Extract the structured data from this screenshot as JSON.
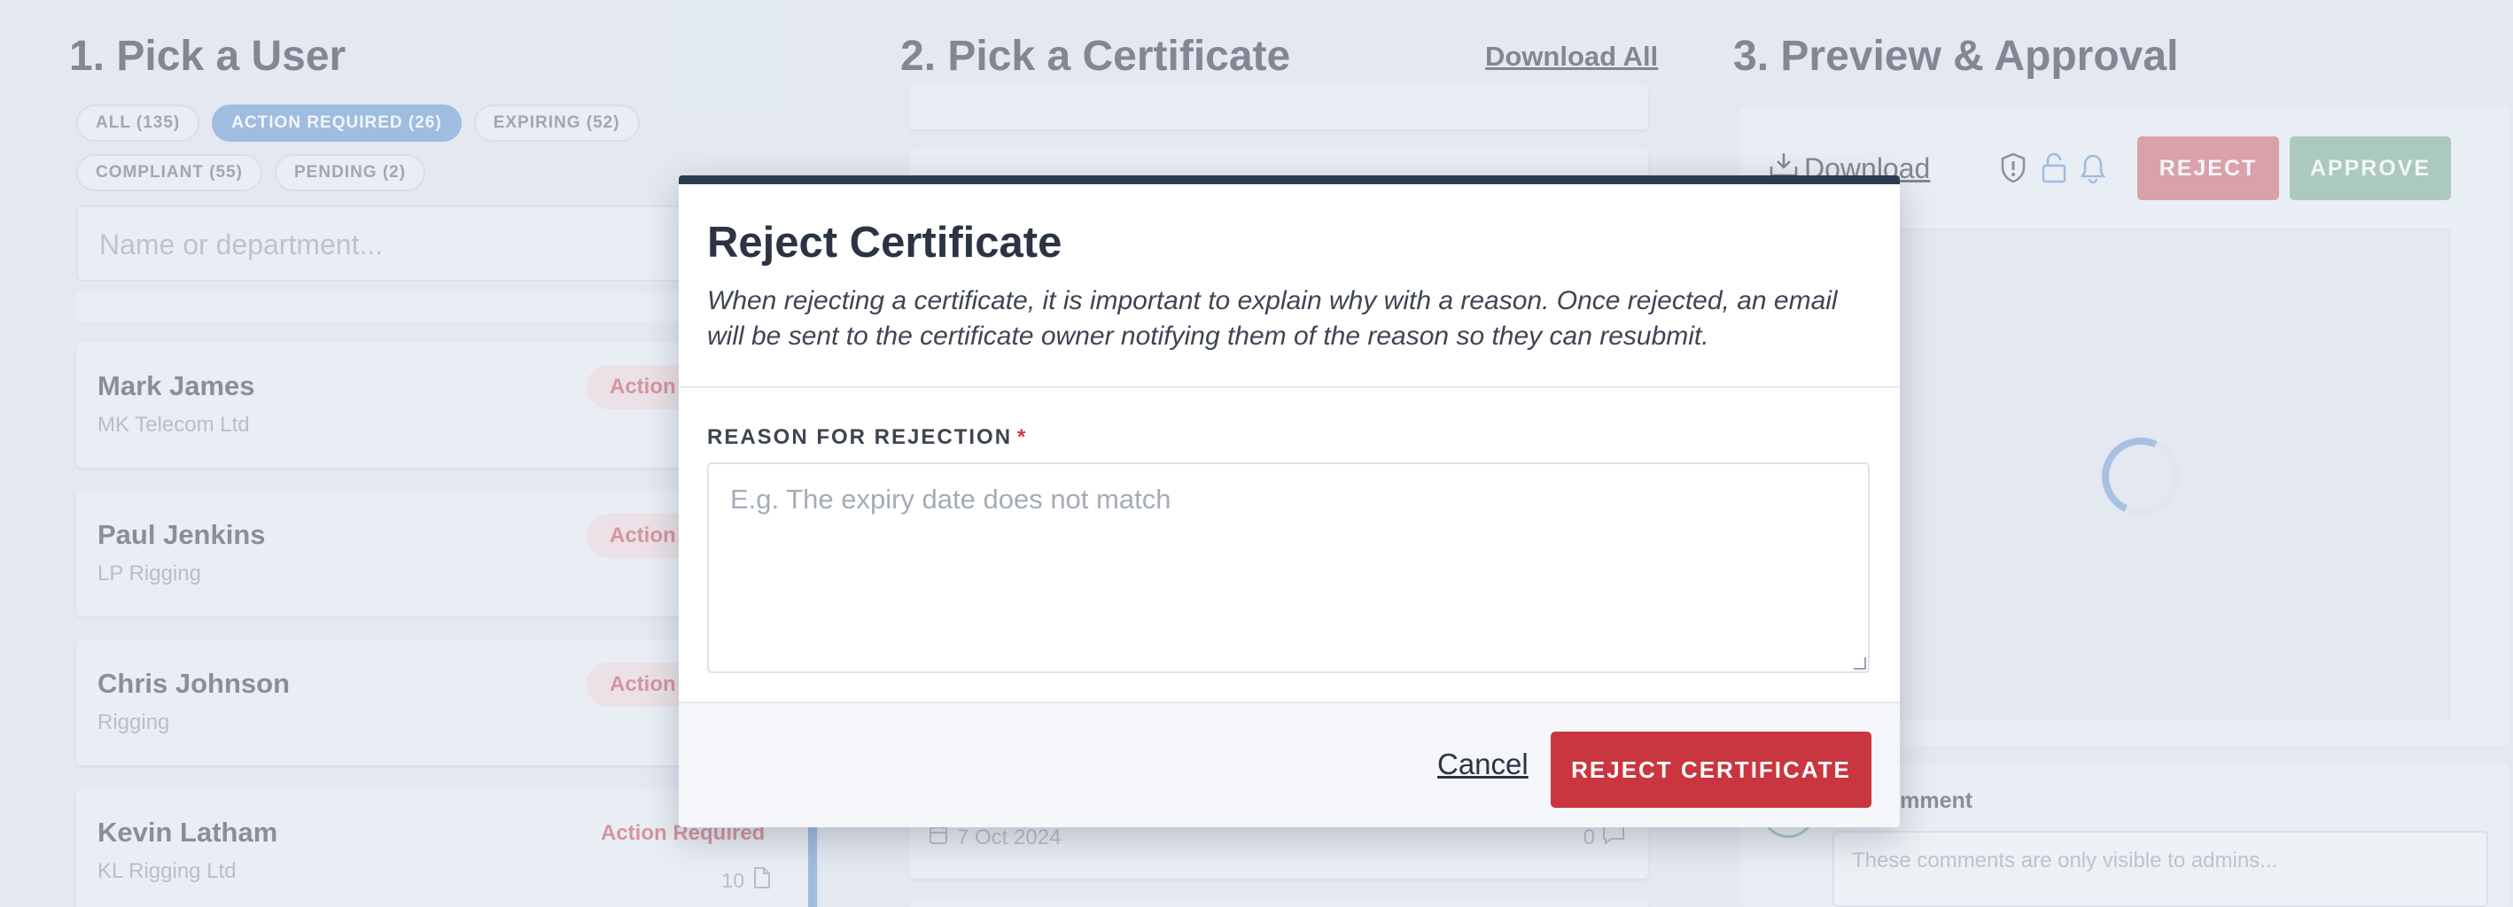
{
  "columns": {
    "users_title": "1. Pick a User",
    "certs_title": "2. Pick a Certificate",
    "download_all": "Download All",
    "preview_title": "3. Preview & Approval"
  },
  "filters": [
    {
      "label": "ALL (135)",
      "active": false
    },
    {
      "label": "ACTION REQUIRED (26)",
      "active": true
    },
    {
      "label": "EXPIRING (52)",
      "active": false
    },
    {
      "label": "COMPLIANT (55)",
      "active": false
    },
    {
      "label": "PENDING (2)",
      "active": false
    }
  ],
  "search": {
    "placeholder": "Name or department..."
  },
  "users": [
    {
      "name": "Mark James",
      "company": "MK Telecom Ltd",
      "status": "Action"
    },
    {
      "name": "Paul Jenkins",
      "company": "LP Rigging",
      "status": "Action"
    },
    {
      "name": "Chris Johnson",
      "company": "Rigging",
      "status": "Action"
    },
    {
      "name": "Kevin Latham",
      "company": "KL Rigging Ltd",
      "status": "Action Required",
      "docs": "10"
    }
  ],
  "certificate": {
    "date": "7 Oct 2024",
    "comments": "0"
  },
  "preview": {
    "download_label": "Download",
    "reject_label": "REJECT",
    "approve_label": "APPROVE"
  },
  "comments": {
    "label": "a Comment",
    "placeholder": "These comments are only visible to admins..."
  },
  "modal": {
    "title": "Reject Certificate",
    "description": "When rejecting a certificate, it is important to explain why with a reason. Once rejected, an email will be sent to the certificate owner notifying them of the reason so they can resubmit.",
    "field_label": "REASON FOR REJECTION",
    "required_mark": "*",
    "placeholder": "E.g. The expiry date does not match",
    "value": "",
    "cancel_label": "Cancel",
    "confirm_label": "REJECT CERTIFICATE"
  },
  "colors": {
    "background": "#e4e9f2",
    "accent_blue": "#6e9ed6",
    "danger": "#c9363f",
    "approve_green": "#86b39a",
    "modal_header": "#2d3b4f"
  }
}
